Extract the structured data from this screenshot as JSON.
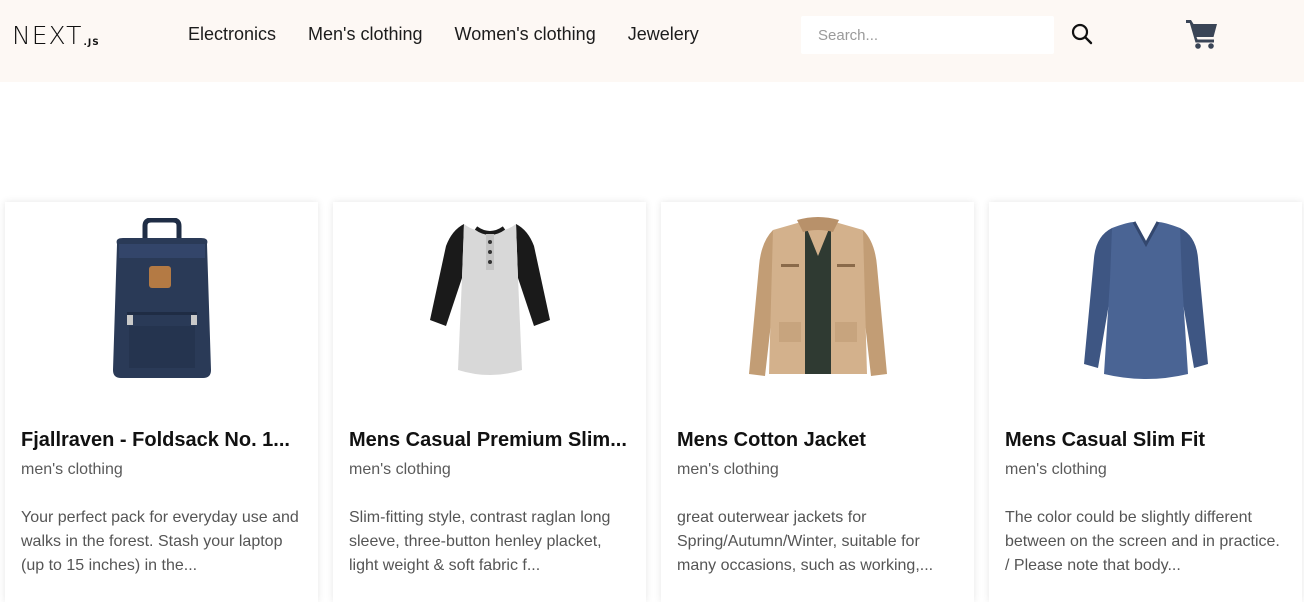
{
  "header": {
    "logo_main": "NEXT",
    "logo_sub": ".JS",
    "nav": [
      "Electronics",
      "Men's clothing",
      "Women's clothing",
      "Jewelery"
    ],
    "search": {
      "placeholder": "Search...",
      "value": ""
    },
    "icons": {
      "search": "search-icon",
      "cart": "shopping-cart-icon"
    },
    "background": "#fdf8f4"
  },
  "products": [
    {
      "title": "Fjallraven - Foldsack No. 1...",
      "category": "men's clothing",
      "description": "Your perfect pack for everyday use and walks in the forest. Stash your laptop (up to 15 inches) in the...",
      "image": "backpack-image"
    },
    {
      "title": "Mens Casual Premium Slim...",
      "category": "men's clothing",
      "description": "Slim-fitting style, contrast raglan long sleeve, three-button henley placket, light weight & soft fabric f...",
      "image": "henley-tshirt-image"
    },
    {
      "title": "Mens Cotton Jacket",
      "category": "men's clothing",
      "description": "great outerwear jackets for Spring/Autumn/Winter, suitable for many occasions, such as working,...",
      "image": "cotton-jacket-image"
    },
    {
      "title": "Mens Casual Slim Fit",
      "category": "men's clothing",
      "description": "The color could be slightly different between on the screen and in practice. / Please note that body...",
      "image": "long-sleeve-shirt-image"
    }
  ]
}
